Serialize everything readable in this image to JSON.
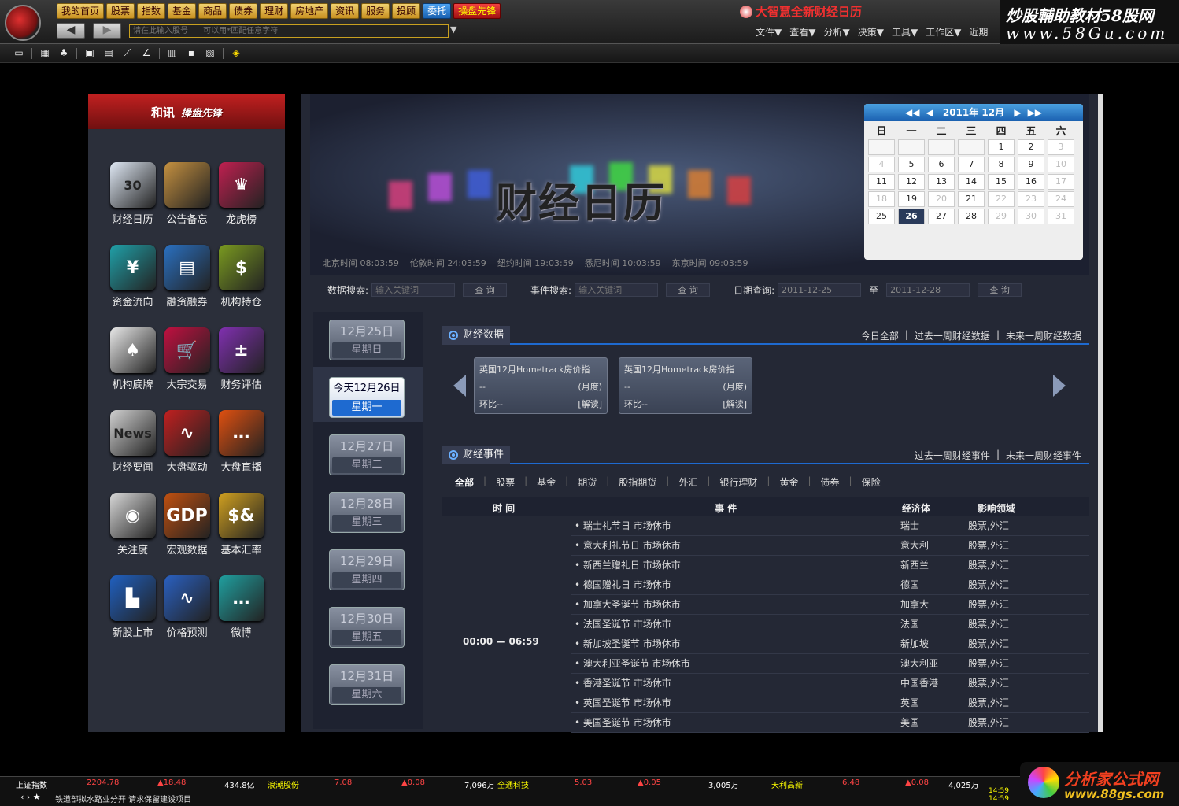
{
  "topbar": {
    "nav": [
      "我的首页",
      "股票",
      "指数",
      "基金",
      "商品",
      "债券",
      "理财",
      "房地产",
      "资讯",
      "服务",
      "投顾",
      "委托",
      "操盘先锋"
    ],
    "cmd_placeholder": "请在此输入股号      可以用*匹配任意字符",
    "marquee": "大智慧全新财经日历",
    "menus": [
      "文件▼",
      "查看▼",
      "分析▼",
      "决策▼",
      "工具▼",
      "工作区▼",
      "近期"
    ],
    "watermark_a": "炒股輔助教材58股网",
    "watermark_b": "www.58Gu.com"
  },
  "left": {
    "brand": "和讯",
    "sub": "操盘先锋",
    "apps": [
      {
        "label": "财经日历",
        "glyph": "30",
        "color": "#dfe8f4"
      },
      {
        "label": "公告备忘",
        "glyph": "",
        "color": "#c49040"
      },
      {
        "label": "龙虎榜",
        "glyph": "♛",
        "color": "#c02050"
      },
      {
        "label": "资金流向",
        "glyph": "¥",
        "color": "#20a0a8"
      },
      {
        "label": "融资融券",
        "glyph": "▤",
        "color": "#2a70c0"
      },
      {
        "label": "机构持仓",
        "glyph": "$",
        "color": "#7a9a20"
      },
      {
        "label": "机构底牌",
        "glyph": "♠",
        "color": "#e8e8e8"
      },
      {
        "label": "大宗交易",
        "glyph": "🛒",
        "color": "#c01040"
      },
      {
        "label": "财务评估",
        "glyph": "±",
        "color": "#8030b0"
      },
      {
        "label": "财经要闻",
        "glyph": "News",
        "color": "#d0d0d0"
      },
      {
        "label": "大盘驱动",
        "glyph": "∿",
        "color": "#c02020"
      },
      {
        "label": "大盘直播",
        "glyph": "…",
        "color": "#e05010"
      },
      {
        "label": "关注度",
        "glyph": "◉",
        "color": "#d8d8d8"
      },
      {
        "label": "宏观数据",
        "glyph": "GDP",
        "color": "#c05010"
      },
      {
        "label": "基本汇率",
        "glyph": "$&",
        "color": "#d0a020"
      },
      {
        "label": "新股上市",
        "glyph": "▙",
        "color": "#2060c0"
      },
      {
        "label": "价格预测",
        "glyph": "∿",
        "color": "#2a60c0"
      },
      {
        "label": "微博",
        "glyph": "…",
        "color": "#20a0a0"
      }
    ]
  },
  "banner": {
    "title": "财经日历",
    "times": [
      "北京时间 08:03:59",
      "伦敦时间 24:03:59",
      "纽约时间 19:03:59",
      "悉尼时间 10:03:59",
      "东京时间 09:03:59"
    ]
  },
  "calendar": {
    "title": "2011年 12月",
    "weekdays": [
      "日",
      "一",
      "二",
      "三",
      "四",
      "五",
      "六"
    ],
    "days": [
      [
        "",
        "",
        "",
        "",
        "1",
        "2",
        "3"
      ],
      [
        "4",
        "5",
        "6",
        "7",
        "8",
        "9",
        "10"
      ],
      [
        "11",
        "12",
        "13",
        "14",
        "15",
        "16",
        "17"
      ],
      [
        "18",
        "19",
        "20",
        "21",
        "22",
        "23",
        "24"
      ],
      [
        "25",
        "26",
        "27",
        "28",
        "29",
        "30",
        "31"
      ]
    ],
    "today": "26"
  },
  "search": {
    "data_label": "数据搜索:",
    "data_placeholder": "输入关键词",
    "event_label": "事件搜索:",
    "event_placeholder": "输入关键词",
    "date_label": "日期查询:",
    "date_from": "2011-12-25",
    "to": "至",
    "date_to": "2011-12-28",
    "btn": "查 询"
  },
  "dates": [
    {
      "d": "12月25日",
      "w": "星期日"
    },
    {
      "d": "今天12月26日",
      "w": "星期一",
      "today": true
    },
    {
      "d": "12月27日",
      "w": "星期二"
    },
    {
      "d": "12月28日",
      "w": "星期三"
    },
    {
      "d": "12月29日",
      "w": "星期四"
    },
    {
      "d": "12月30日",
      "w": "星期五"
    },
    {
      "d": "12月31日",
      "w": "星期六"
    }
  ],
  "data_section": {
    "title": "财经数据",
    "links": [
      "今日全部",
      "|",
      "过去一周财经数据",
      "|",
      "未来一周财经数据"
    ],
    "cards": [
      {
        "name": "英国12月Hometrack房价指",
        "val": "--",
        "period": "(月度)",
        "chg": "环比--",
        "read": "[解读]"
      },
      {
        "name": "英国12月Hometrack房价指",
        "val": "--",
        "period": "(月度)",
        "chg": "环比--",
        "read": "[解读]"
      }
    ]
  },
  "event_section": {
    "title": "财经事件",
    "links": [
      "过去一周财经事件",
      "|",
      "未来一周财经事件"
    ],
    "filters": [
      "全部",
      "股票",
      "基金",
      "期货",
      "股指期货",
      "外汇",
      "银行理财",
      "黄金",
      "债券",
      "保险"
    ],
    "headers": {
      "time": "时 间",
      "event": "事 件",
      "econ": "经济体",
      "impact": "影响领域"
    },
    "time_range": "00:00 — 06:59",
    "rows": [
      {
        "e": "• 瑞士礼节日 市场休市",
        "c": "瑞士",
        "i": "股票,外汇"
      },
      {
        "e": "• 意大利礼节日 市场休市",
        "c": "意大利",
        "i": "股票,外汇"
      },
      {
        "e": "• 新西兰赠礼日 市场休市",
        "c": "新西兰",
        "i": "股票,外汇"
      },
      {
        "e": "• 德国赠礼日 市场休市",
        "c": "德国",
        "i": "股票,外汇"
      },
      {
        "e": "• 加拿大圣诞节 市场休市",
        "c": "加拿大",
        "i": "股票,外汇"
      },
      {
        "e": "• 法国圣诞节 市场休市",
        "c": "法国",
        "i": "股票,外汇"
      },
      {
        "e": "• 新加坡圣诞节 市场休市",
        "c": "新加坡",
        "i": "股票,外汇"
      },
      {
        "e": "• 澳大利亚圣诞节 市场休市",
        "c": "澳大利亚",
        "i": "股票,外汇"
      },
      {
        "e": "• 香港圣诞节 市场休市",
        "c": "中国香港",
        "i": "股票,外汇"
      },
      {
        "e": "• 英国圣诞节 市场休市",
        "c": "英国",
        "i": "股票,外汇"
      },
      {
        "e": "• 美国圣诞节 市场休市",
        "c": "美国",
        "i": "股票,外汇"
      }
    ]
  },
  "status": {
    "ticker": [
      {
        "t": "上证指数",
        "c": "#fff"
      },
      {
        "t": "2204.78",
        "c": "#f44"
      },
      {
        "t": "▲18.48",
        "c": "#f44"
      },
      {
        "t": "434.8亿",
        "c": "#fff"
      },
      {
        "t": "浪潮股份",
        "c": "#ff0"
      },
      {
        "t": "7.08",
        "c": "#f44"
      },
      {
        "t": "▲0.08",
        "c": "#f44"
      },
      {
        "t": "7,096万",
        "c": "#fff"
      },
      {
        "t": "全通科技",
        "c": "#ff0"
      },
      {
        "t": "5.03",
        "c": "#f44"
      },
      {
        "t": "▲0.05",
        "c": "#f44"
      },
      {
        "t": "3,005万",
        "c": "#fff"
      },
      {
        "t": "天利高新",
        "c": "#ff0"
      },
      {
        "t": "6.48",
        "c": "#f44"
      },
      {
        "t": "▲0.08",
        "c": "#f44"
      },
      {
        "t": "4,025万",
        "c": "#fff"
      }
    ],
    "msg": "铁道部拟水路业分开  请求保留建设项目",
    "clock1": "14:59",
    "clock2": "14:59"
  },
  "watermark_bot": {
    "a": "分析家公式网",
    "b": "www.88gs.com"
  }
}
